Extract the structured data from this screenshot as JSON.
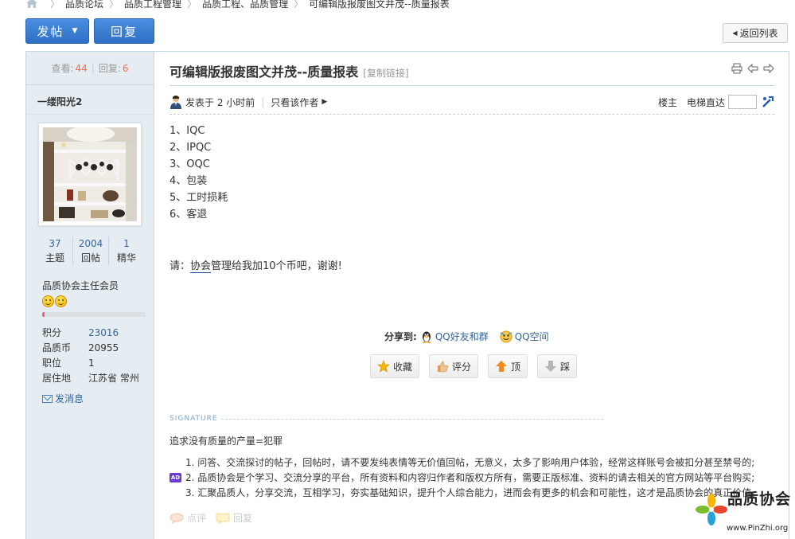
{
  "breadcrumb": {
    "items": [
      "品质论坛",
      "品质工程管理",
      "品质工程、品质管理",
      "可编辑版报废图文并茂--质量报表"
    ]
  },
  "toolbar": {
    "post_label": "发帖",
    "reply_label": "回复",
    "back_label": "返回列表"
  },
  "sidebar": {
    "views_label": "查看:",
    "views": "44",
    "replies_label": "回复:",
    "replies": "6",
    "author": "一缕阳光2",
    "counts": [
      {
        "value": "37",
        "label": "主题"
      },
      {
        "value": "2004",
        "label": "回帖"
      },
      {
        "value": "1",
        "label": "精华"
      }
    ],
    "rank": "品质协会主任会员",
    "level_fraction": 0.02,
    "profile": [
      {
        "key": "积分",
        "value": "23016"
      },
      {
        "key": "品质币",
        "value": "20955"
      },
      {
        "key": "职位",
        "value": "1"
      },
      {
        "key": "居住地",
        "value": "江苏省 常州"
      }
    ],
    "message_label": "发消息"
  },
  "post": {
    "title": "可编辑版报废图文并茂--质量报表",
    "copy_link": "[复制链接]",
    "posted": "发表于 2 小时前",
    "only_author": "只看该作者",
    "floor": "楼主",
    "elevator": "电梯直达",
    "items": [
      "1、IQC",
      "2、IPQC",
      "3、OQC",
      "4、包装",
      "5、工时损耗",
      "6、客退"
    ],
    "plea_prefix": "请：",
    "plea_link": "协会",
    "plea_suffix": "管理给我加10个币吧，谢谢!"
  },
  "share": {
    "label": "分享到:",
    "qq_friends": "QQ好友和群",
    "qq_zone": "QQ空间"
  },
  "actions": {
    "favorite": "收藏",
    "rate": "评分",
    "up": "顶",
    "down": "踩"
  },
  "signature": {
    "heading": "SIGNATURE",
    "line1": "追求没有质量的产量=犯罪",
    "rules": [
      "1. 问答、交流探讨的帖子，回帖时，请不要发纯表情等无价值回帖，无意义，太多了影响用户体验，经常这样账号会被扣分甚至禁号的;",
      "2. 品质协会是个学习、交流分享的平台，所有资料和内容归作者和版权方所有，需要正版标准、资料的请去相关的官方网站等平台购买;",
      "3. 汇聚品质人，分享交流，互相学习，夯实基础知识，提升个人综合能力，进而会有更多的机会和可能性，这才是品质协会的真正价值。"
    ],
    "ad_badge": "AD"
  },
  "footer": {
    "comment": "点评",
    "reply": "回复"
  },
  "watermark": {
    "name": "品质协会",
    "url": "www.PinZhi.org"
  },
  "colors": {
    "accent_blue": "#2d6fc5",
    "number_red": "#f26c4f",
    "link_blue": "#336699",
    "sidebar_bg": "#e5edf2",
    "border": "#c2d5e3"
  }
}
